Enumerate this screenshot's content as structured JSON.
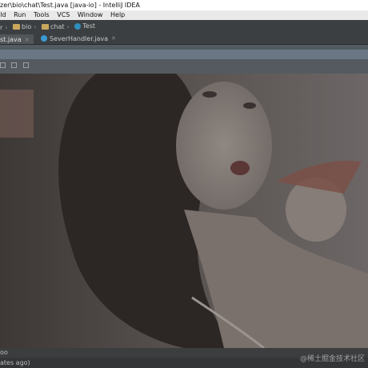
{
  "title_bar": {
    "text": "zer\\bio\\chat\\Test.java [java-io] - IntelliJ IDEA"
  },
  "menu": [
    "ild",
    "Run",
    "Tools",
    "VCS",
    "Window",
    "Help"
  ],
  "breadcrumbs": [
    {
      "label": "r",
      "icon": "none"
    },
    {
      "label": "bio",
      "icon": "folder-icon"
    },
    {
      "label": "chat",
      "icon": "folder-icon"
    },
    {
      "label": "Test",
      "icon": "class-icon"
    }
  ],
  "tabs": [
    {
      "label": "st.java",
      "active": true
    },
    {
      "label": "SeverHandler.java",
      "active": false
    }
  ],
  "status": {
    "line1": "oo",
    "line2": "ates ago)"
  },
  "watermark": "@稀土掘金技术社区",
  "colors": {
    "ide_dark": "#3c3f41",
    "accent": "#4a88c7"
  }
}
